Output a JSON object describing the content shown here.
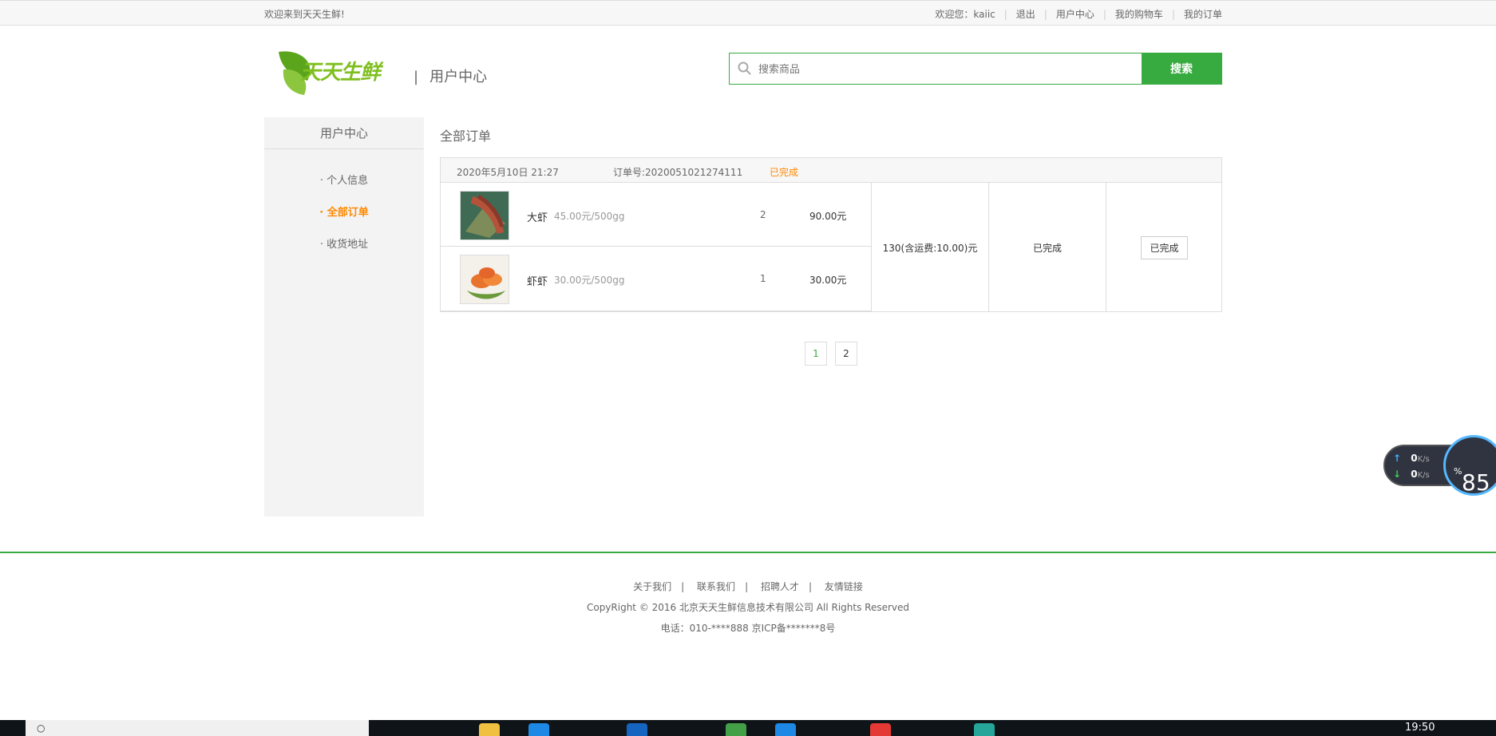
{
  "topbar": {
    "welcome": "欢迎来到天天生鲜!",
    "greeting": "欢迎您：kaiic",
    "logout": "退出",
    "user_center": "用户中心",
    "cart": "我的购物车",
    "orders": "我的订单"
  },
  "header": {
    "logo_text": "天天生鲜",
    "sub_title": "用户中心",
    "search_placeholder": "搜索商品",
    "search_button": "搜索"
  },
  "sidebar": {
    "title": "用户中心",
    "items": [
      {
        "label": "· 个人信息",
        "active": false
      },
      {
        "label": "· 全部订单",
        "active": true
      },
      {
        "label": "· 收货地址",
        "active": false
      }
    ]
  },
  "main": {
    "title": "全部订单",
    "order": {
      "time": "2020年5月10日 21:27",
      "order_no": "订单号:2020051021274111",
      "status_header": "已完成",
      "items": [
        {
          "name": "大虾",
          "price": "45.00元/500gg",
          "qty": "2",
          "subtotal": "90.00元"
        },
        {
          "name": "虾虾",
          "price": "30.00元/500gg",
          "qty": "1",
          "subtotal": "30.00元"
        }
      ],
      "total": "130(含运费:10.00)元",
      "status": "已完成",
      "action": "已完成"
    },
    "pages": [
      "1",
      "2"
    ]
  },
  "footer": {
    "links": [
      "关于我们",
      "联系我们",
      "招聘人才",
      "友情链接"
    ],
    "copyright": "CopyRight © 2016 北京天天生鲜信息技术有限公司 All Rights Reserved",
    "tel": "电话：010-****888 京ICP备*******8号"
  },
  "overlay": {
    "up": "0",
    "down": "0",
    "unit": "K/s",
    "percent": "85",
    "pct_sign": "%"
  },
  "taskbar": {
    "clock": "19:50"
  },
  "colors": {
    "accent": "#37ab40",
    "active": "#ff8800"
  }
}
